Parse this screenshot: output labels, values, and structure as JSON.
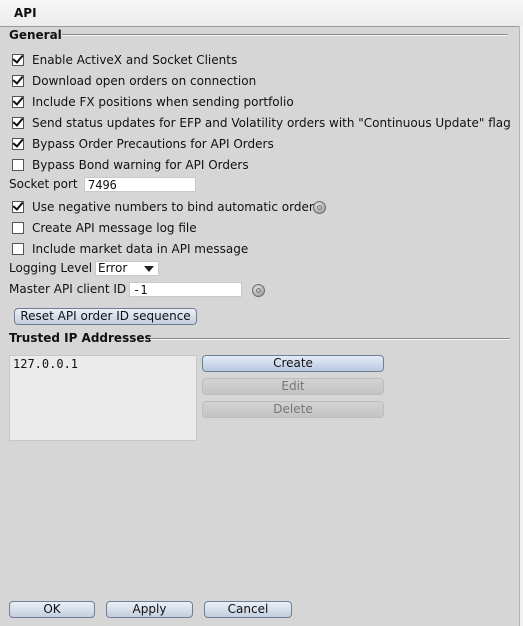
{
  "window": {
    "title": "API"
  },
  "general": {
    "title": "General",
    "options": [
      {
        "label": "Enable ActiveX and Socket Clients",
        "checked": true
      },
      {
        "label": "Download open orders on connection",
        "checked": true
      },
      {
        "label": "Include FX positions when sending portfolio",
        "checked": true
      },
      {
        "label": "Send status updates for EFP and Volatility orders with \"Continuous Update\" flag",
        "checked": true
      },
      {
        "label": "Bypass Order Precautions for API Orders",
        "checked": true
      },
      {
        "label": "Bypass Bond warning for API Orders",
        "checked": false
      }
    ],
    "socket_port": {
      "label": "Socket port",
      "value": "7496"
    },
    "options2": [
      {
        "label": "Use negative numbers to bind automatic orders",
        "checked": true
      },
      {
        "label": "Create API message log file",
        "checked": false
      },
      {
        "label": "Include market data in API message",
        "checked": false
      }
    ],
    "logging_level": {
      "label": "Logging Level",
      "value": "Error"
    },
    "master_client_id": {
      "label": "Master API client ID",
      "value": "-1"
    },
    "reset_button": "Reset API order ID sequence"
  },
  "trusted_ips": {
    "title": "Trusted IP Addresses",
    "items": [
      "127.0.0.1"
    ],
    "buttons": {
      "create": "Create",
      "edit": "Edit",
      "delete": "Delete"
    }
  },
  "footer": {
    "ok": "OK",
    "apply": "Apply",
    "cancel": "Cancel"
  },
  "icons": {
    "help": "help-icon",
    "dropdown": "chevron-down-icon"
  }
}
